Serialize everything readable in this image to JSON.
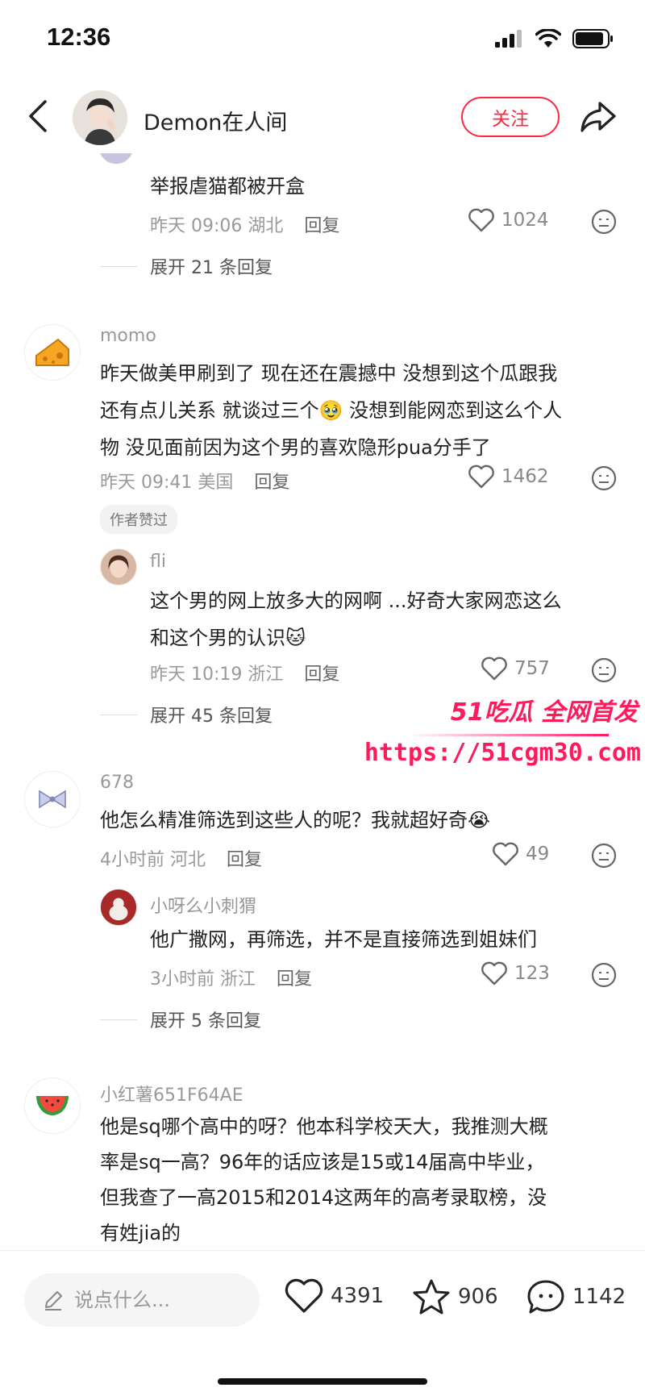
{
  "status": {
    "time": "12:36"
  },
  "header": {
    "username": "Demon在人间",
    "follow_label": "关注"
  },
  "comments": [
    {
      "text": "举报虐猫都被开盒",
      "time": "昨天 09:06",
      "location": "湖北",
      "reply_label": "回复",
      "likes": "1024",
      "expand_label": "展开 21 条回复"
    },
    {
      "username": "momo",
      "lines": [
        "昨天做美甲刷到了 现在还在震撼中 没想到这个瓜跟我",
        "还有点儿关系 就谈过三个🥹 没想到能网恋到这么个人",
        "物 没见面前因为这个男的喜欢隐形pua分手了"
      ],
      "time": "昨天 09:41",
      "location": "美国",
      "reply_label": "回复",
      "likes": "1462",
      "badge": "作者赞过",
      "reply": {
        "username": "fli",
        "lines": [
          "这个男的网上放多大的网啊 ...好奇大家网恋这么",
          "和这个男的认识🐱"
        ],
        "time": "昨天 10:19",
        "location": "浙江",
        "reply_label": "回复",
        "likes": "757"
      },
      "expand_label": "展开 45 条回复"
    },
    {
      "username": "678",
      "text": "他怎么精准筛选到这些人的呢？我就超好奇😭",
      "time": "4小时前",
      "location": "河北",
      "reply_label": "回复",
      "likes": "49",
      "reply": {
        "username": "小呀么小刺猬",
        "text": "他广撒网，再筛选，并不是直接筛选到姐妹们",
        "time": "3小时前",
        "location": "浙江",
        "reply_label": "回复",
        "likes": "123"
      },
      "expand_label": "展开 5 条回复"
    },
    {
      "username": "小红薯651F64AE",
      "lines": [
        "他是sq哪个高中的呀？他本科学校天大，我推测大概",
        "率是sq一高？96年的话应该是15或14届高中毕业，",
        "但我查了一高2015和2014这两年的高考录取榜，没",
        "有姓jia的"
      ]
    }
  ],
  "watermark": {
    "brand": "51吃瓜 全网首发",
    "url": "https://51cgm30.com"
  },
  "bottom": {
    "input_placeholder": "说点什么...",
    "likes": "4391",
    "stars": "906",
    "comments": "1142"
  },
  "icons": [
    "back-icon",
    "share-icon",
    "heart-icon",
    "dislike-icon",
    "pencil-icon",
    "star-icon",
    "chat-icon"
  ]
}
